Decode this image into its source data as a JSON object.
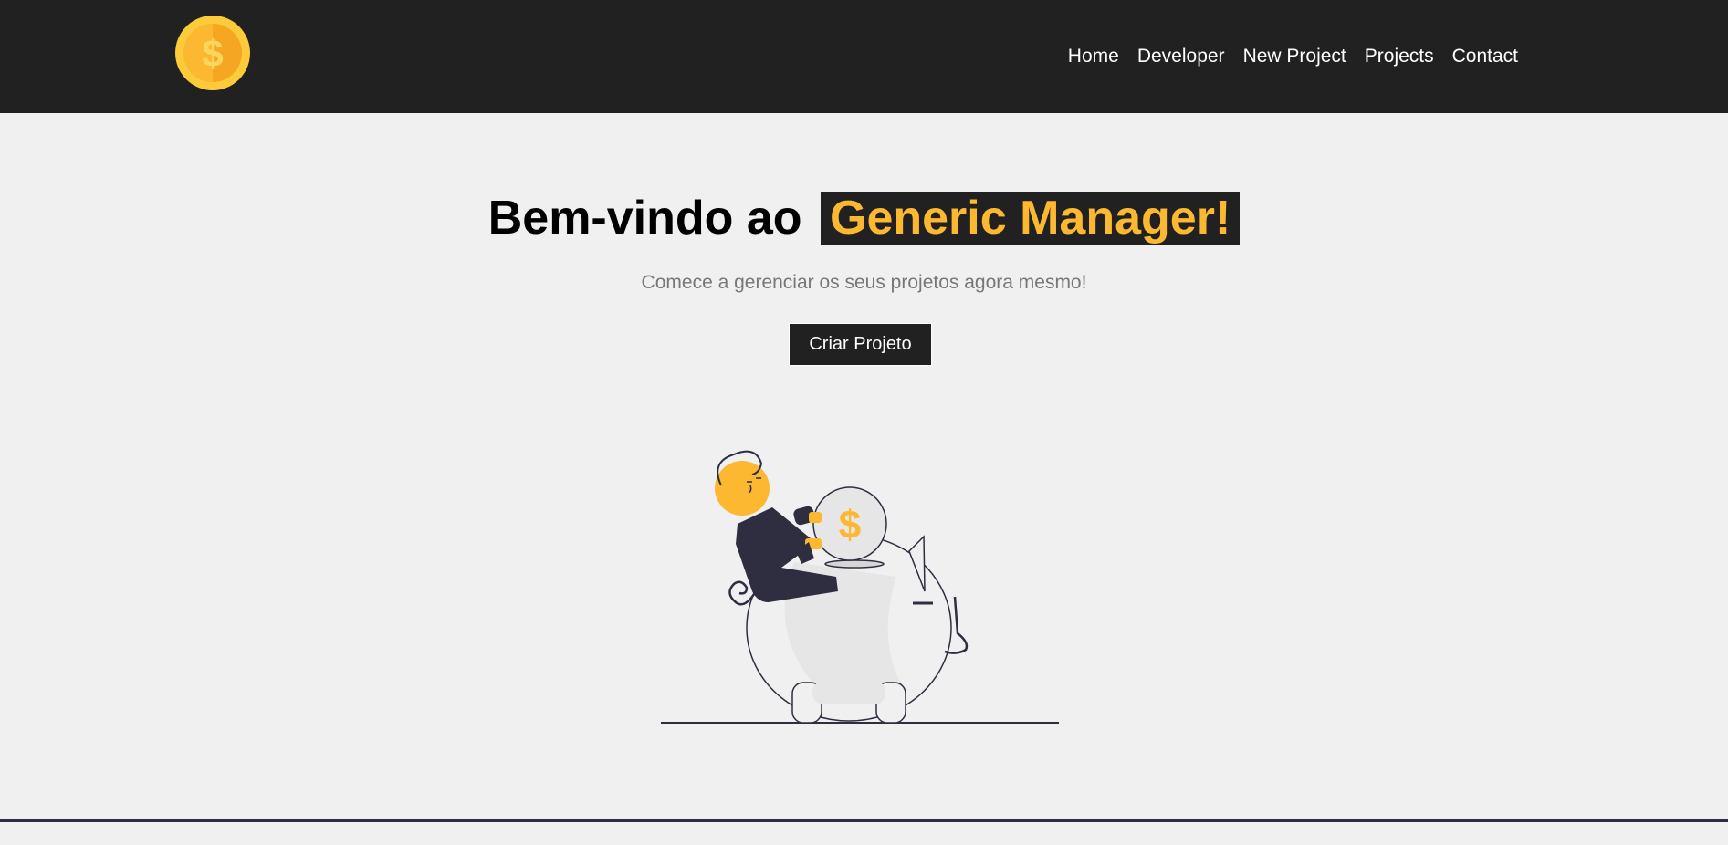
{
  "brand": {
    "logo_icon": "dollar-coin-icon",
    "colors": {
      "accent": "#fbb830",
      "dark": "#212121",
      "background": "#f0f0f0"
    }
  },
  "nav": {
    "items": [
      {
        "label": "Home"
      },
      {
        "label": "Developer"
      },
      {
        "label": "New Project"
      },
      {
        "label": "Projects"
      },
      {
        "label": "Contact"
      }
    ]
  },
  "hero": {
    "title_prefix": "Bem-vindo ao",
    "title_highlight": "Generic Manager!",
    "subtitle": "Comece a gerenciar os seus projetos agora mesmo!",
    "cta_label": "Criar Projeto",
    "illustration": "person-putting-coin-in-piggy-bank-illustration"
  }
}
